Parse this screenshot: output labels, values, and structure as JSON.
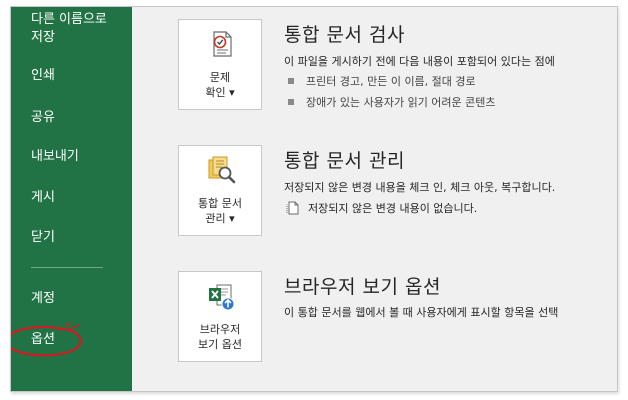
{
  "sidebar": {
    "items": [
      {
        "label_line1": "다른 이름으로",
        "label_line2": "저장"
      },
      {
        "label": "인쇄"
      },
      {
        "label": "공유"
      },
      {
        "label": "내보내기"
      },
      {
        "label": "게시"
      },
      {
        "label": "닫기"
      },
      {
        "label": "계정"
      },
      {
        "label": "옵션"
      }
    ],
    "color": "#217346",
    "highlight_color": "#e0141e"
  },
  "sections": {
    "check": {
      "button_line1": "문제",
      "button_line2": "확인 ▾",
      "title": "통합 문서 검사",
      "desc": "이 파일을 게시하기 전에 다음 내용이 포함되어 있다는 점에",
      "bullets": [
        "프린터 경고, 만든 이 이름, 절대 경로",
        "장애가 있는 사용자가 읽기 어려운 콘텐츠"
      ]
    },
    "manage": {
      "button_line1": "통합 문서",
      "button_line2": "관리 ▾",
      "title": "통합 문서 관리",
      "desc": "저장되지 않은 변경 내용을 체크 인, 체크 아웃, 복구합니다.",
      "status": "저장되지 않은 변경 내용이 없습니다."
    },
    "browser": {
      "button_line1": "브라우저",
      "button_line2": "보기 옵션",
      "title": "브라우저 보기 옵션",
      "desc": "이 통합 문서를 웹에서 볼 때 사용자에게 표시할 항목을 선택"
    }
  },
  "icons": {
    "check": "inspect-document-icon",
    "manage": "manage-workbook-icon",
    "browser": "excel-browser-view-icon",
    "status": "document-page-icon"
  }
}
